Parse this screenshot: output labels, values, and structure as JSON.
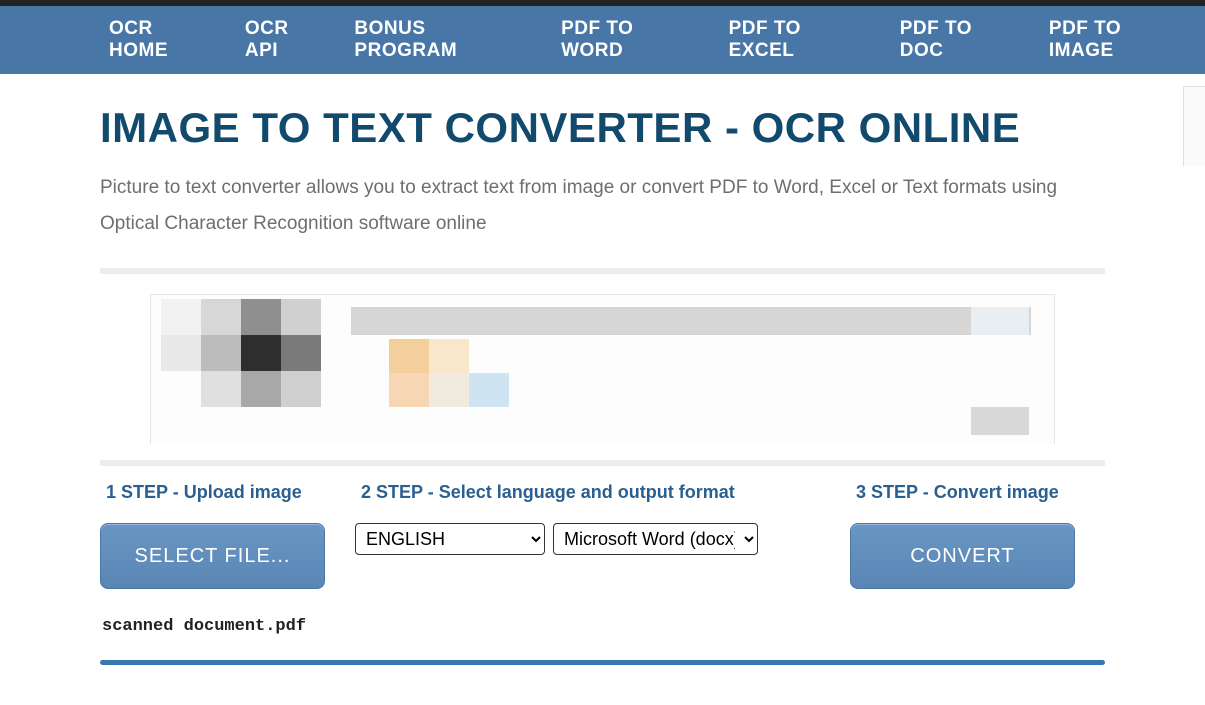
{
  "nav": {
    "items": [
      "OCR HOME",
      "OCR API",
      "BONUS PROGRAM",
      "PDF TO WORD",
      "PDF TO EXCEL",
      "PDF TO DOC",
      "PDF TO IMAGE"
    ]
  },
  "header": {
    "title": "IMAGE TO TEXT CONVERTER - OCR ONLINE",
    "description": "Picture to text converter allows you to extract text from image or convert PDF to Word, Excel or Text formats using Optical Character Recognition software online"
  },
  "steps": {
    "step1": {
      "label": "1 STEP - Upload image",
      "button": "SELECT FILE..."
    },
    "step2": {
      "label": "2 STEP - Select language and output format",
      "language_selected": "ENGLISH",
      "format_selected": "Microsoft Word (docx)"
    },
    "step3": {
      "label": "3 STEP - Convert image",
      "button": "CONVERT"
    }
  },
  "uploaded_file": "scanned document.pdf",
  "colors": {
    "nav_bg": "#4877a7",
    "heading": "#124a6e",
    "step_label": "#2a5f91",
    "button_bg": "#5f8cbc"
  }
}
